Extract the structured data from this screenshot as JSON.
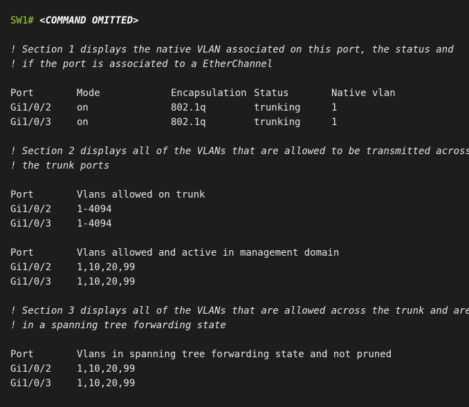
{
  "command": {
    "prompt": "SW1#",
    "text": "<COMMAND OMITTED>"
  },
  "section1": {
    "comment_lines": [
      "! Section 1 displays the native VLAN associated on this port, the status and",
      "! if the port is associated to a EtherChannel"
    ],
    "headers": [
      "Port",
      "Mode",
      "Encapsulation",
      "Status",
      "Native vlan"
    ],
    "rows": [
      [
        "Gi1/0/2",
        "on",
        "802.1q",
        "trunking",
        "1"
      ],
      [
        "Gi1/0/3",
        "on",
        "802.1q",
        "trunking",
        "1"
      ]
    ]
  },
  "section2": {
    "comment_lines": [
      "! Section 2 displays all of the VLANs that are allowed to be transmitted across",
      "! the trunk ports"
    ],
    "table_a": {
      "headers": [
        "Port",
        "Vlans allowed on trunk"
      ],
      "rows": [
        [
          "Gi1/0/2",
          "1-4094"
        ],
        [
          "Gi1/0/3",
          "1-4094"
        ]
      ]
    },
    "table_b": {
      "headers": [
        "Port",
        "Vlans allowed and active in management domain"
      ],
      "rows": [
        [
          "Gi1/0/2",
          "1,10,20,99"
        ],
        [
          "Gi1/0/3",
          "1,10,20,99"
        ]
      ]
    }
  },
  "section3": {
    "comment_lines": [
      "! Section 3 displays all of the VLANs that are allowed across the trunk and are",
      "! in a spanning tree forwarding state"
    ],
    "headers": [
      "Port",
      "Vlans in spanning tree forwarding state and not pruned"
    ],
    "rows": [
      [
        "Gi1/0/2",
        "1,10,20,99"
      ],
      [
        "Gi1/0/3",
        "1,10,20,99"
      ]
    ]
  },
  "colors": {
    "background": "#1d1d1d",
    "prompt": "#9bd33c",
    "text": "#e6e6e6"
  }
}
